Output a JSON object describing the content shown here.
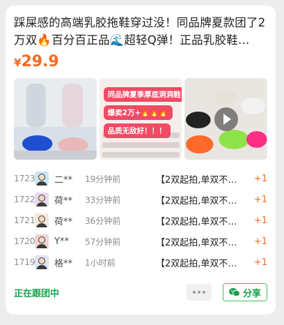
{
  "product": {
    "title": "踩屎感的高端乳胶拖鞋穿过没！同品牌夏款团了2万双🔥百分百正品🌊超轻Q弹！正品乳胶鞋…",
    "price_currency": "¥",
    "price_value": "29.9"
  },
  "gallery": {
    "images": [
      {
        "icon": "slippers-photo"
      },
      {
        "icon": "promo-poster",
        "tags": [
          "同品牌夏季厚底洞洞鞋",
          "爆卖2万+🔥🔥🔥",
          "品质无敌好！！！"
        ]
      },
      {
        "icon": "video-thumbnail"
      }
    ]
  },
  "orders": [
    {
      "rank": "1723",
      "user": "二**",
      "time": "19分钟前",
      "message": "【2双起拍,单双不…",
      "qty": "+1"
    },
    {
      "rank": "1722",
      "user": "荷**",
      "time": "33分钟前",
      "message": "【2双起拍,单双不…",
      "qty": "+1"
    },
    {
      "rank": "1721",
      "user": "荷**",
      "time": "36分钟前",
      "message": "【2双起拍,单双不…",
      "qty": "+1"
    },
    {
      "rank": "1720",
      "user": "Y**",
      "time": "57分钟前",
      "message": "【2双起拍,单双不…",
      "qty": "+1"
    },
    {
      "rank": "1719",
      "user": "格**",
      "time": "1小时前",
      "message": "【2双起拍,单双不…",
      "qty": "+1"
    }
  ],
  "footer": {
    "status": "正在跟团中",
    "share_label": "分享"
  },
  "colors": {
    "accent_price": "#f26a21",
    "status_green": "#17a34a",
    "tag_pink": "#f04a64"
  }
}
